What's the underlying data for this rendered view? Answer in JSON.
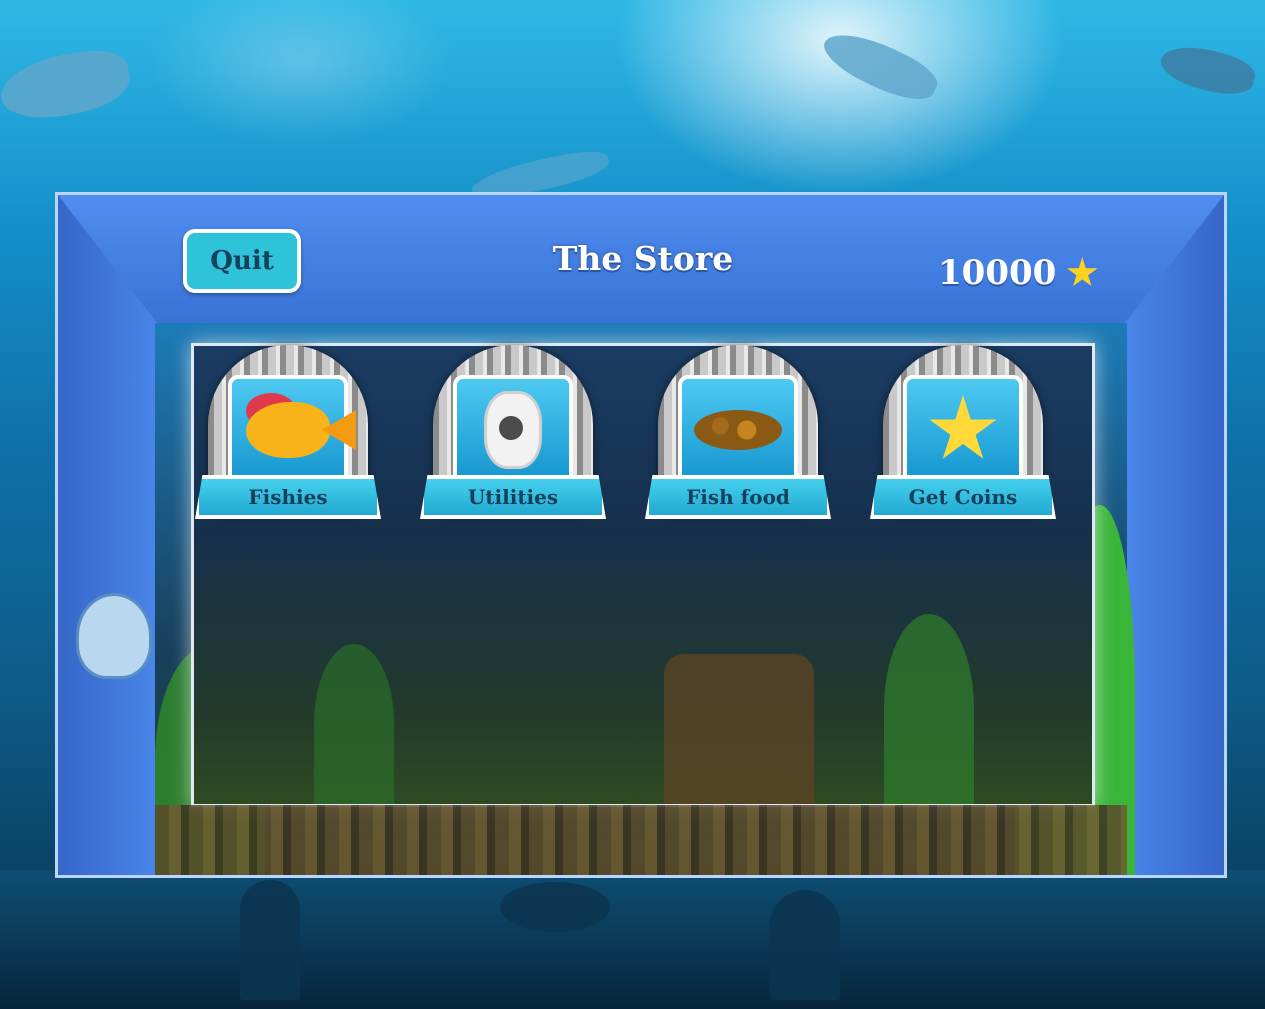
{
  "store": {
    "title": "The Store",
    "quit_label": "Quit",
    "coins": "10000",
    "coin_icon": "star-icon"
  },
  "categories": [
    {
      "label": "Fishies",
      "icon": "fish-icon"
    },
    {
      "label": "Utilities",
      "icon": "filter-icon"
    },
    {
      "label": "Fish food",
      "icon": "food-pellets-icon"
    },
    {
      "label": "Get Coins",
      "icon": "stars-icon"
    }
  ],
  "colors": {
    "frame": "#3a72d6",
    "button": "#2ec3d9",
    "label_text": "#16415a",
    "coin": "#ffd21f"
  }
}
